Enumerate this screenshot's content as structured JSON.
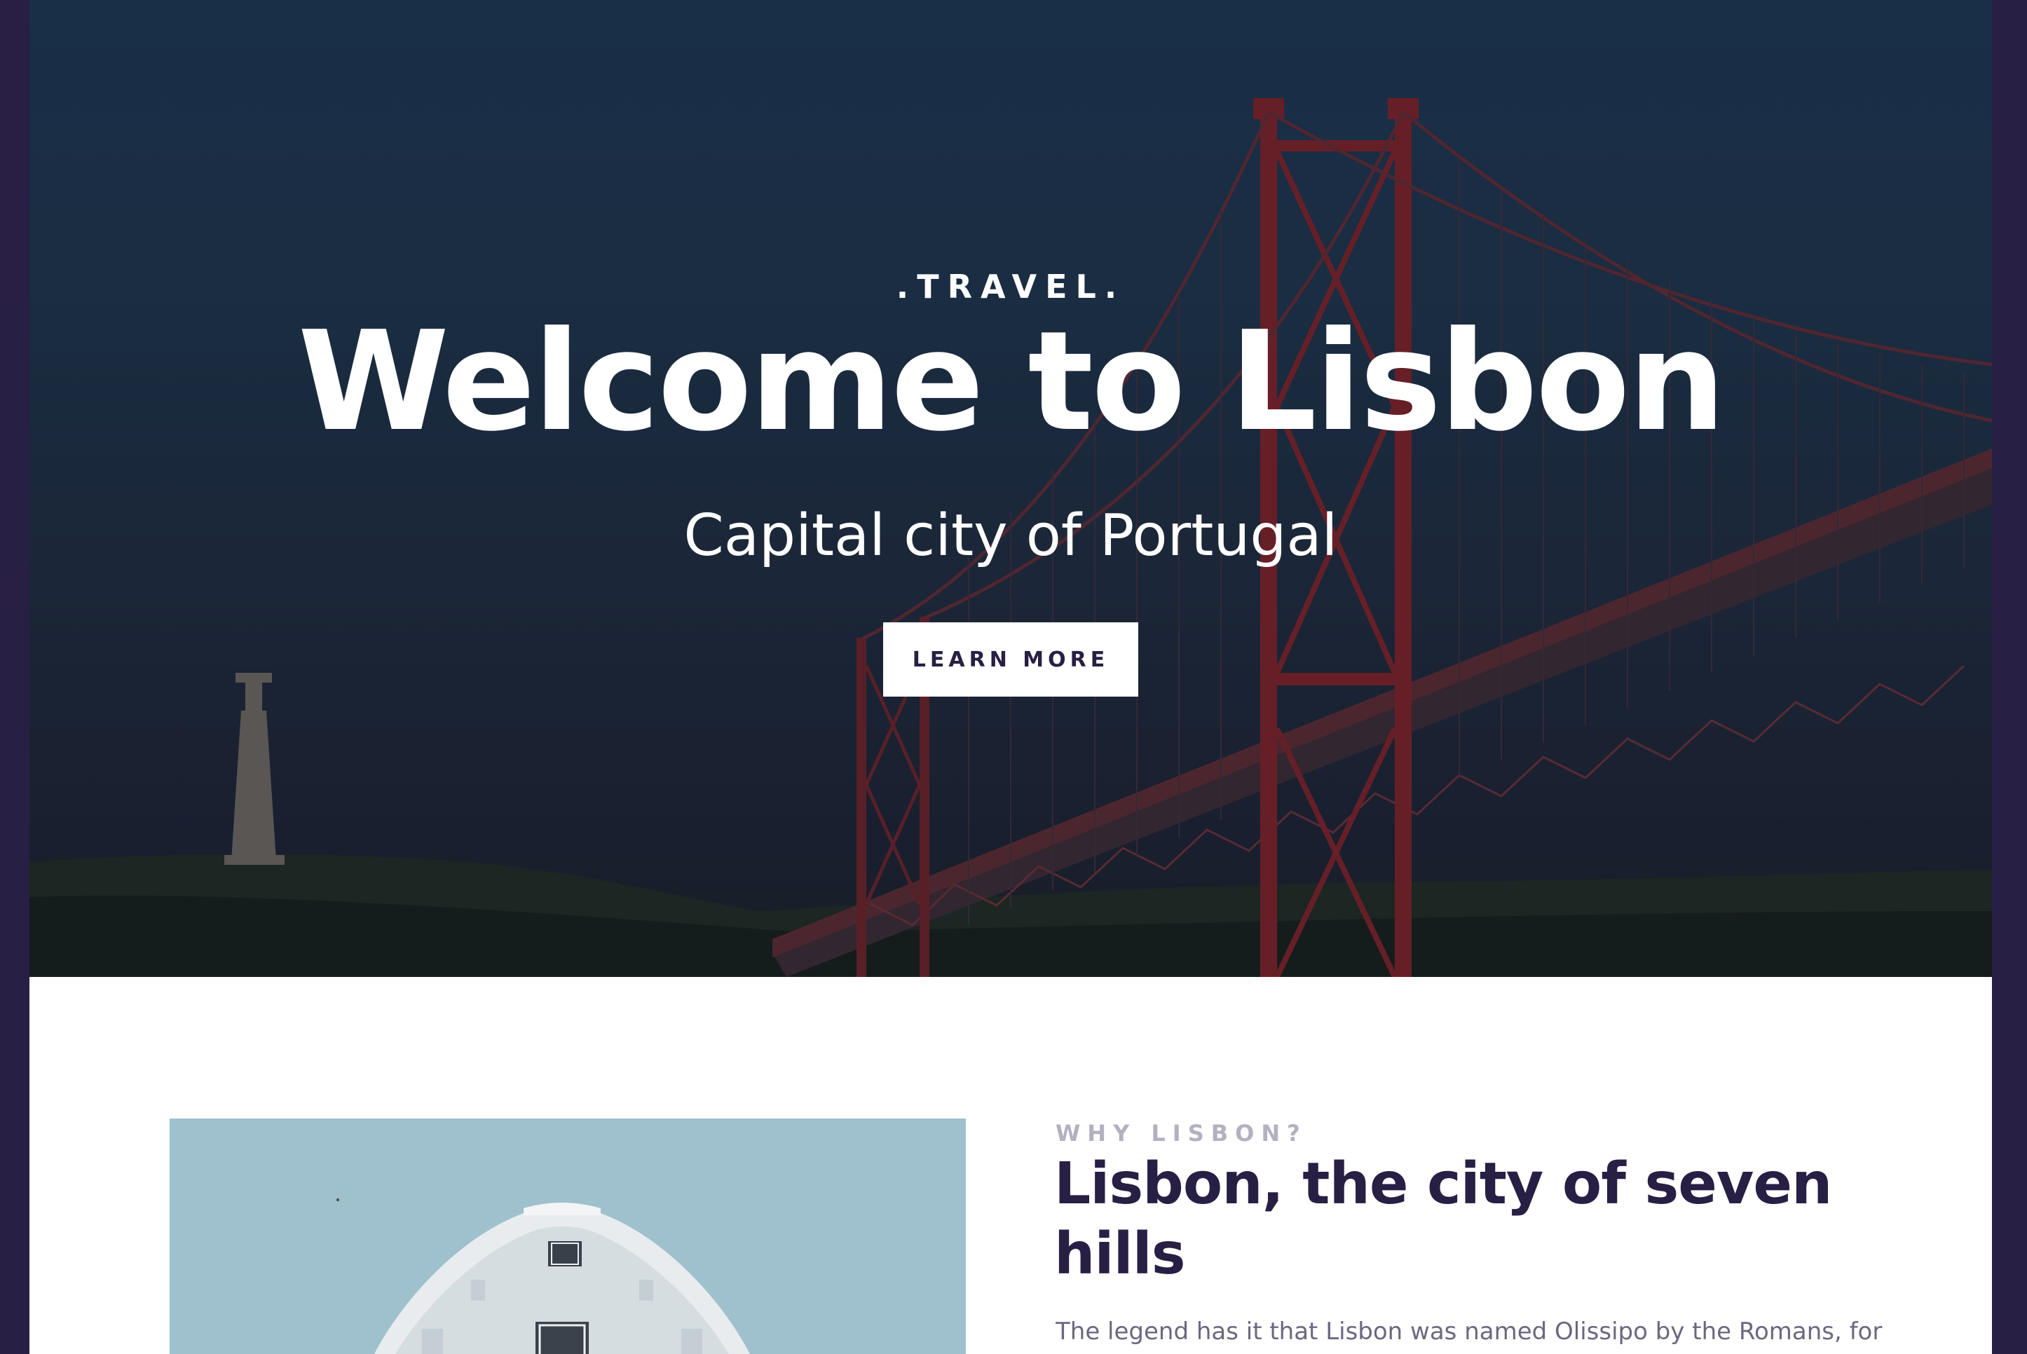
{
  "hero": {
    "kicker": ".TRAVEL.",
    "title": "Welcome to Lisbon",
    "subtitle": "Capital city of Portugal",
    "button_label": "LEARN MORE"
  },
  "intro": {
    "kicker": "WHY LISBON?",
    "title": "Lisbon, the city of seven hills",
    "body": "The legend has it that Lisbon was named Olissipo by the Romans, for"
  },
  "colors": {
    "frame": "#271f44",
    "heading": "#271f44",
    "muted": "#b3b1c0",
    "body_text": "#6b6880",
    "bridge": "#7a2228"
  }
}
